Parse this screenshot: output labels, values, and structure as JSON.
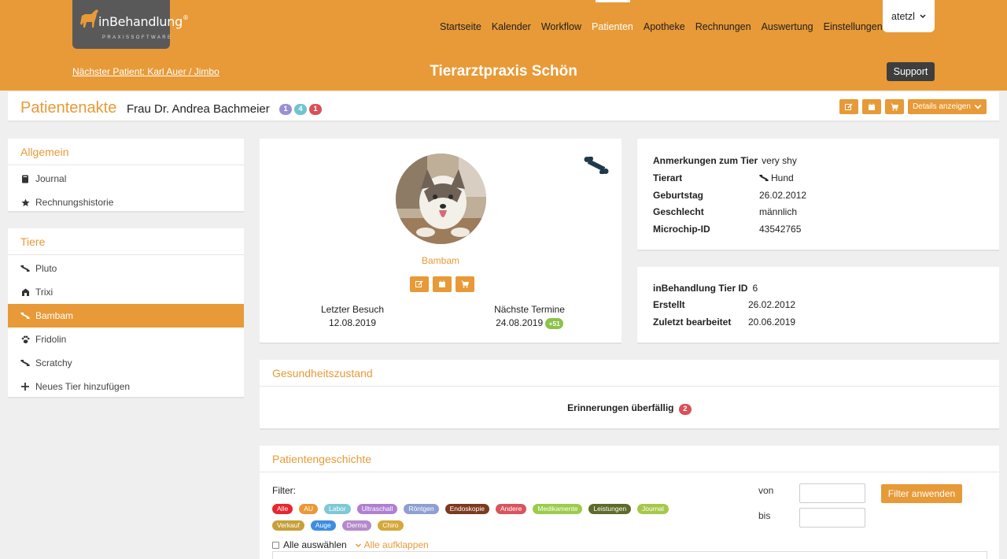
{
  "brand": {
    "logo_text": "inBehandlung",
    "logo_reg": "®",
    "logo_sub": "PRAXISSOFTWARE"
  },
  "nav": {
    "items": [
      "Startseite",
      "Kalender",
      "Workflow",
      "Patienten",
      "Apotheke",
      "Rechnungen",
      "Auswertung",
      "Einstellungen"
    ],
    "active": "Patienten"
  },
  "user": {
    "name": "atetzl",
    "icon": "chevron-down-icon"
  },
  "topline": {
    "next_patient": "Nächster Patient: Karl Auer / Jimbo",
    "practice": "Tierarztpraxis Schön",
    "support": "Support"
  },
  "header": {
    "title": "Patientenakte",
    "owner": "Frau Dr. Andrea Bachmeier",
    "badges": [
      "1",
      "4",
      "1"
    ],
    "details_label": "Details anzeigen"
  },
  "sidebar": {
    "general_title": "Allgemein",
    "general_items": [
      {
        "label": "Journal",
        "icon": "book-icon"
      },
      {
        "label": "Rechnungshistorie",
        "icon": "star-icon"
      }
    ],
    "pets_title": "Tiere",
    "pets": [
      {
        "label": "Pluto",
        "icon": "bone-icon"
      },
      {
        "label": "Trixi",
        "icon": "cat-icon"
      },
      {
        "label": "Bambam",
        "icon": "bone-icon"
      },
      {
        "label": "Fridolin",
        "icon": "paw-icon"
      },
      {
        "label": "Scratchy",
        "icon": "bone-icon"
      },
      {
        "label": "Neues Tier hinzufügen",
        "icon": "plus-icon"
      }
    ],
    "active_pet": "Bambam"
  },
  "pet": {
    "name": "Bambam",
    "last_visit_label": "Letzter Besuch",
    "last_visit": "12.08.2019",
    "next_label": "Nächste Termine",
    "next": "24.08.2019",
    "next_badge": "+51"
  },
  "details": {
    "remarks_label": "Anmerkungen zum Tier",
    "remarks": "very shy",
    "species_label": "Tierart",
    "species": "Hund",
    "birthday_label": "Geburtstag",
    "birthday": "26.02.2012",
    "sex_label": "Geschlecht",
    "sex": "männlich",
    "chip_label": "Microchip-ID",
    "chip": "43542765"
  },
  "meta": {
    "id_label": "inBehandlung Tier ID",
    "id": "6",
    "created_label": "Erstellt",
    "created": "26.02.2012",
    "edited_label": "Zuletzt bearbeitet",
    "edited": "20.06.2019"
  },
  "health": {
    "title": "Gesundheitszustand",
    "reminders_label": "Erinnerungen überfällig",
    "reminders_count": "2"
  },
  "history": {
    "title": "Patientengeschichte",
    "filter_label": "Filter:",
    "tags": [
      {
        "label": "Alle",
        "color": "#e8262f"
      },
      {
        "label": "AU",
        "color": "#e79a37"
      },
      {
        "label": "Labor",
        "color": "#7fc9d6"
      },
      {
        "label": "Ultraschall",
        "color": "#b07fd1"
      },
      {
        "label": "Röntgen",
        "color": "#8e9fd4"
      },
      {
        "label": "Endoskopie",
        "color": "#7c3a20"
      },
      {
        "label": "Andere",
        "color": "#d9545d"
      },
      {
        "label": "Medikamente",
        "color": "#9ccc4a"
      },
      {
        "label": "Leistungen",
        "color": "#5e6b2a"
      },
      {
        "label": "Journal",
        "color": "#a6c84a"
      },
      {
        "label": "Verkauf",
        "color": "#c7a03a"
      },
      {
        "label": "Auge",
        "color": "#3d8de0"
      },
      {
        "label": "Derma",
        "color": "#b58acb"
      },
      {
        "label": "Chiro",
        "color": "#d6a83b"
      }
    ],
    "from_label": "von",
    "to_label": "bis",
    "apply_label": "Filter anwenden",
    "select_all": "Alle auswählen",
    "expand_all": "Alle aufklappen"
  }
}
